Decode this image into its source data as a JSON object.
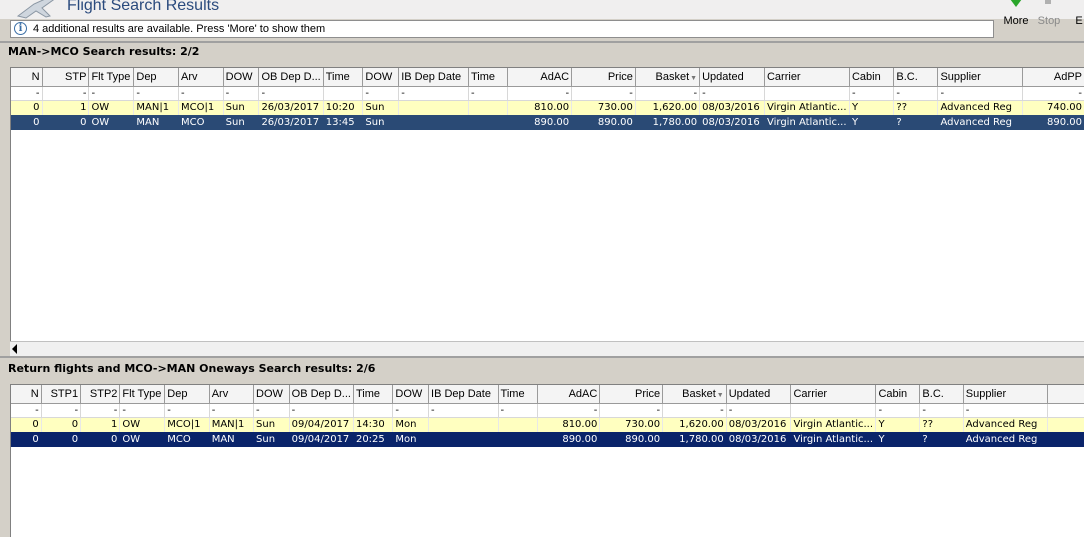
{
  "header": {
    "title": "Flight Search Results",
    "toolbar": {
      "more_label": "More",
      "stop_label": "Stop",
      "e_label": "E"
    }
  },
  "info": {
    "text": "4 additional results are available. Press 'More' to show them",
    "icon": "info-icon"
  },
  "outbound": {
    "title": "MAN->MCO Search results: 2/2",
    "columns": [
      "N",
      "STP",
      "Flt Type",
      "Dep",
      "Arv",
      "DOW",
      "OB Dep D...",
      "Time",
      "DOW",
      "IB Dep Date",
      "Time",
      "AdAC",
      "Price",
      "Basket",
      "Updated",
      "Carrier",
      "Cabin",
      "B.C.",
      "Supplier",
      "AdPP"
    ],
    "filter": [
      "-",
      "-",
      "-",
      "-",
      "-",
      "-",
      "-",
      "",
      "-",
      "-",
      "-",
      "-",
      "-",
      "-",
      "-",
      "",
      "-",
      "-",
      "-",
      "-"
    ],
    "rows": [
      [
        "0",
        "1",
        "OW",
        "MAN|1",
        "MCO|1",
        "Sun",
        "26/03/2017",
        "10:20",
        "Sun",
        "",
        "",
        "810.00",
        "730.00",
        "1,620.00",
        "08/03/2016",
        "Virgin Atlantic...",
        "Y",
        "??",
        "Advanced Reg",
        "740.00"
      ],
      [
        "0",
        "0",
        "OW",
        "MAN",
        "MCO",
        "Sun",
        "26/03/2017",
        "13:45",
        "Sun",
        "",
        "",
        "890.00",
        "890.00",
        "1,780.00",
        "08/03/2016",
        "Virgin Atlantic...",
        "Y",
        "?",
        "Advanced Reg",
        "890.00"
      ]
    ]
  },
  "return": {
    "title": "Return flights and MCO->MAN Oneways Search results: 2/6",
    "columns": [
      "N",
      "STP1",
      "STP2",
      "Flt Type",
      "Dep",
      "Arv",
      "DOW",
      "OB Dep D...",
      "Time",
      "DOW",
      "IB Dep Date",
      "Time",
      "AdAC",
      "Price",
      "Basket",
      "Updated",
      "Carrier",
      "Cabin",
      "B.C.",
      "Supplier",
      ""
    ],
    "filter": [
      "-",
      "-",
      "-",
      "-",
      "-",
      "-",
      "-",
      "-",
      "",
      "-",
      "-",
      "-",
      "-",
      "-",
      "-",
      "-",
      "",
      "-",
      "-",
      "-",
      ""
    ],
    "rows": [
      [
        "0",
        "0",
        "1",
        "OW",
        "MCO|1",
        "MAN|1",
        "Sun",
        "09/04/2017",
        "14:30",
        "Mon",
        "",
        "",
        "810.00",
        "730.00",
        "1,620.00",
        "08/03/2016",
        "Virgin Atlantic...",
        "Y",
        "??",
        "Advanced Reg",
        ""
      ],
      [
        "0",
        "0",
        "0",
        "OW",
        "MCO",
        "MAN",
        "Sun",
        "09/04/2017",
        "20:25",
        "Mon",
        "",
        "",
        "890.00",
        "890.00",
        "1,780.00",
        "08/03/2016",
        "Virgin Atlantic...",
        "Y",
        "?",
        "Advanced Reg",
        ""
      ]
    ]
  },
  "colors": {
    "highlight_row": "#ffffc0",
    "selected_row": "#0a246a",
    "title_color": "#2a4a7d"
  }
}
